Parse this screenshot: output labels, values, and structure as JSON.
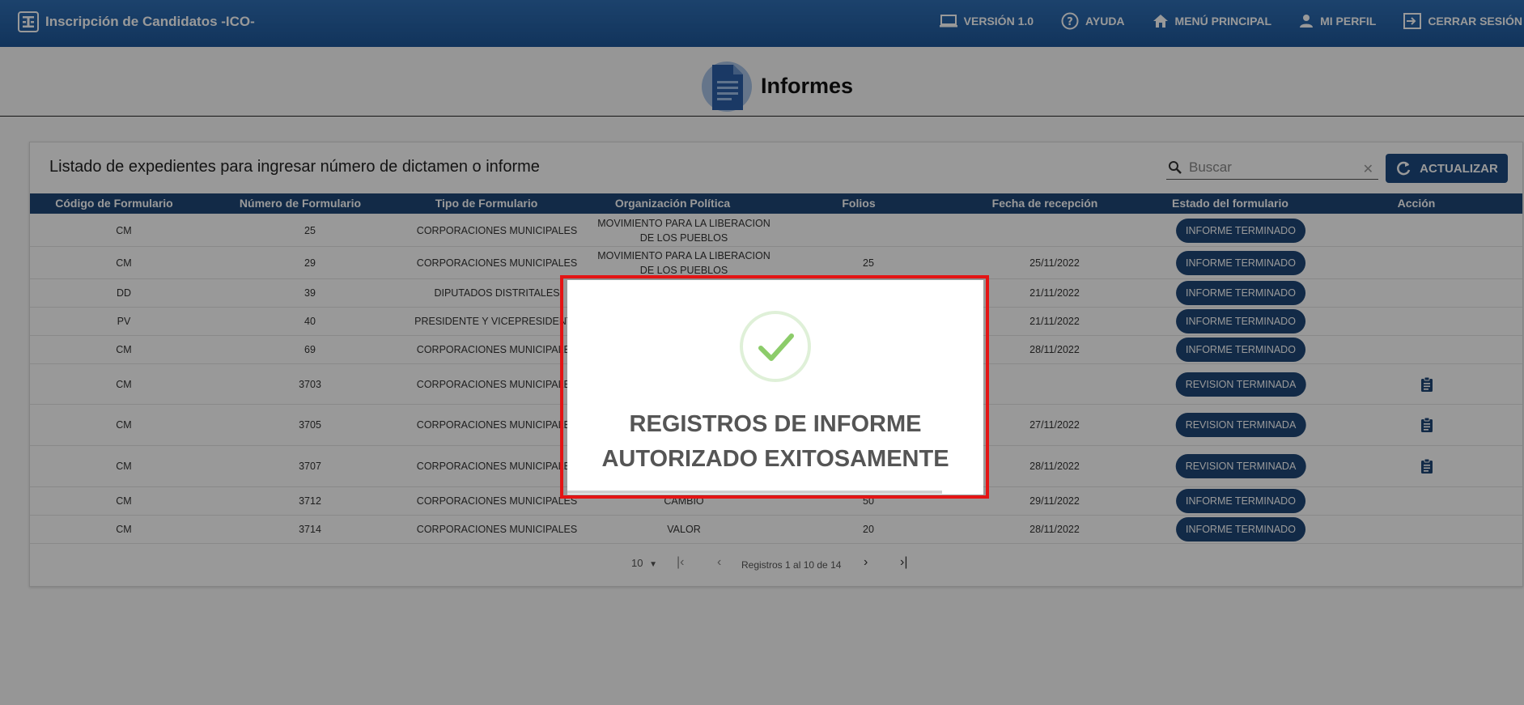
{
  "app": {
    "title": "Inscripción de Candidatos -ICO-"
  },
  "nav": {
    "version": "VERSIÓN 1.0",
    "help": "AYUDA",
    "main_menu": "MENÚ PRINCIPAL",
    "profile": "MI PERFIL",
    "logout": "CERRAR SESIÓN"
  },
  "page": {
    "title": "Informes"
  },
  "card": {
    "title": "Listado de expedientes para ingresar número de dictamen o informe",
    "search_placeholder": "Buscar",
    "refresh_label": "ACTUALIZAR"
  },
  "table": {
    "headers": [
      "Código de Formulario",
      "Número de Formulario",
      "Tipo de Formulario",
      "Organización Política",
      "Folios",
      "Fecha de recepción",
      "Estado del formulario",
      "Acción"
    ],
    "rows": [
      {
        "codigo": "CM",
        "numero": "25",
        "tipo": "CORPORACIONES MUNICIPALES",
        "org1": "MOVIMIENTO PARA LA LIBERACION",
        "org2": "DE LOS PUEBLOS",
        "folios": "",
        "fecha": "",
        "estado": "INFORME TERMINADO",
        "accion": false
      },
      {
        "codigo": "CM",
        "numero": "29",
        "tipo": "CORPORACIONES MUNICIPALES",
        "org1": "MOVIMIENTO PARA LA LIBERACION",
        "org2": "DE LOS PUEBLOS",
        "folios": "25",
        "fecha": "25/11/2022",
        "estado": "INFORME TERMINADO",
        "accion": false
      },
      {
        "codigo": "DD",
        "numero": "39",
        "tipo": "DIPUTADOS DISTRITALES",
        "org1": "",
        "org2": "",
        "folios": "",
        "fecha": "21/11/2022",
        "estado": "INFORME TERMINADO",
        "accion": false
      },
      {
        "codigo": "PV",
        "numero": "40",
        "tipo": "PRESIDENTE Y VICEPRESIDENTE",
        "org1": "",
        "org2": "",
        "folios": "",
        "fecha": "21/11/2022",
        "estado": "INFORME TERMINADO",
        "accion": false
      },
      {
        "codigo": "CM",
        "numero": "69",
        "tipo": "CORPORACIONES MUNICIPALES",
        "org1": "",
        "org2": "",
        "folios": "",
        "fecha": "28/11/2022",
        "estado": "INFORME TERMINADO",
        "accion": false
      },
      {
        "codigo": "CM",
        "numero": "3703",
        "tipo": "CORPORACIONES MUNICIPALES",
        "org1": "",
        "org2": "",
        "folios": "",
        "fecha": "",
        "estado": "REVISION TERMINADA",
        "accion": true
      },
      {
        "codigo": "CM",
        "numero": "3705",
        "tipo": "CORPORACIONES MUNICIPALES",
        "org1": "",
        "org2": "",
        "folios": "",
        "fecha": "27/11/2022",
        "estado": "REVISION TERMINADA",
        "accion": true
      },
      {
        "codigo": "CM",
        "numero": "3707",
        "tipo": "CORPORACIONES MUNICIPALES",
        "org1": "",
        "org2": "",
        "folios": "",
        "fecha": "28/11/2022",
        "estado": "REVISION TERMINADA",
        "accion": true
      },
      {
        "codigo": "CM",
        "numero": "3712",
        "tipo": "CORPORACIONES MUNICIPALES",
        "org1": "CAMBIO",
        "org2": "",
        "folios": "50",
        "fecha": "29/11/2022",
        "estado": "INFORME TERMINADO",
        "accion": false
      },
      {
        "codigo": "CM",
        "numero": "3714",
        "tipo": "CORPORACIONES MUNICIPALES",
        "org1": "VALOR",
        "org2": "",
        "folios": "20",
        "fecha": "28/11/2022",
        "estado": "INFORME TERMINADO",
        "accion": false
      }
    ]
  },
  "pagination": {
    "page_size": "10",
    "summary": "Registros 1 al 10 de 14"
  },
  "modal": {
    "line1": "REGISTROS DE INFORME",
    "line2": "AUTORIZADO EXITOSAMENTE"
  },
  "colors": {
    "topbar": "#1e5799",
    "header_row": "#1e4677",
    "pill": "#1e4677",
    "modal_outline": "#e41414",
    "check": "#8ccc6a"
  },
  "icons": [
    "app-logo-icon",
    "monitor-icon",
    "help-icon",
    "home-icon",
    "person-icon",
    "logout-icon",
    "document-icon",
    "search-icon",
    "clear-icon",
    "refresh-icon",
    "clipboard-icon",
    "chevron-down-icon",
    "first-page-icon",
    "chevron-left-icon",
    "chevron-right-icon",
    "last-page-icon",
    "check-icon"
  ]
}
